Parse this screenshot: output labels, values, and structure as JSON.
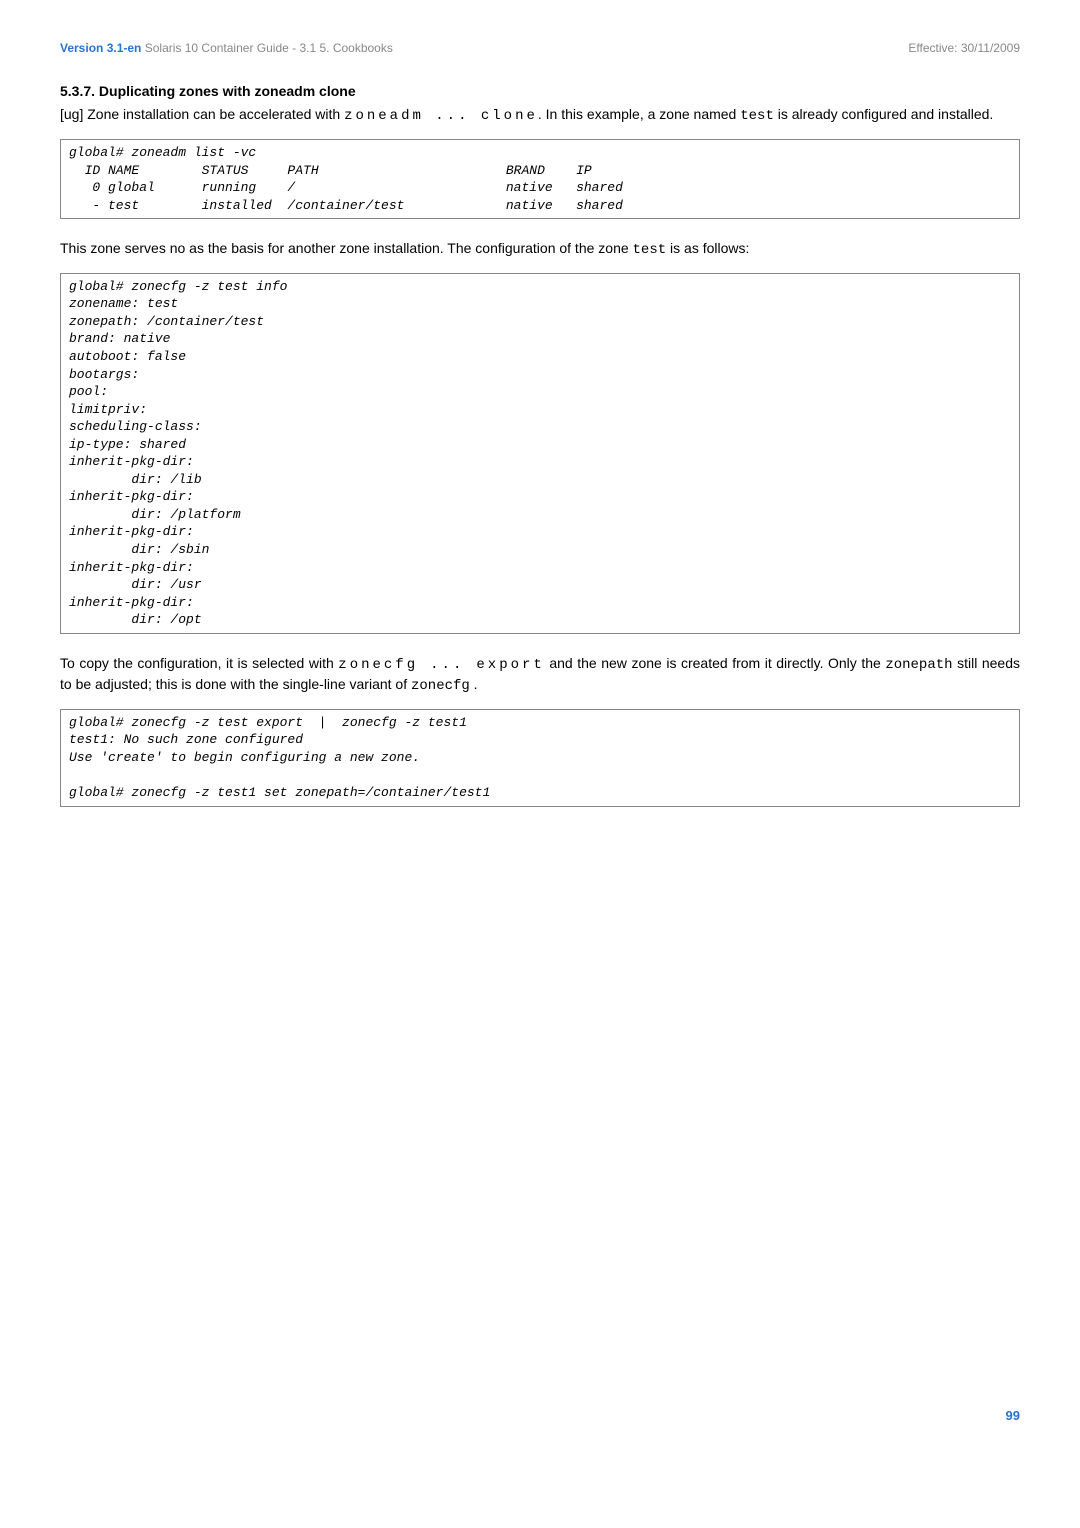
{
  "header": {
    "version": "Version 3.1-en",
    "title": "Solaris 10 Container Guide - 3.1  5. Cookbooks",
    "effective": "Effective: 30/11/2009"
  },
  "section": {
    "number": "5.3.7.",
    "title": "Duplicating zones with zoneadm clone"
  },
  "p1": {
    "prefix": "[ug] Zone installation can be accelerated with ",
    "cmd": "zoneadm ... clone",
    "mid": ". In this example, a zone named ",
    "name": "test",
    "suffix": " is already configured and installed."
  },
  "code1": "global# zoneadm list -vc\n  ID NAME        STATUS     PATH                        BRAND    IP\n   0 global      running    /                           native   shared\n   - test        installed  /container/test             native   shared",
  "p2": {
    "prefix": "This zone serves no as the basis for another zone installation. The configuration of the zone ",
    "name": "test",
    "suffix": " is as follows:"
  },
  "code2": "global# zonecfg -z test info\nzonename: test\nzonepath: /container/test\nbrand: native\nautoboot: false\nbootargs:\npool:\nlimitpriv:\nscheduling-class:\nip-type: shared\ninherit-pkg-dir:\n        dir: /lib\ninherit-pkg-dir:\n        dir: /platform\ninherit-pkg-dir:\n        dir: /sbin\ninherit-pkg-dir:\n        dir: /usr\ninherit-pkg-dir:\n        dir: /opt",
  "p3": {
    "prefix": "To copy the configuration, it is selected with ",
    "cmd": "zonecfg ... export",
    "mid1": " and the new zone is created from it directly. Only the ",
    "zp": "zonepath",
    "mid2": " still needs to be adjusted; this is done with the single-line variant of ",
    "zc": "zonecfg",
    "suffix": " ."
  },
  "code3": "global# zonecfg -z test export  |  zonecfg -z test1\ntest1: No such zone configured\nUse 'create' to begin configuring a new zone.\n\nglobal# zonecfg -z test1 set zonepath=/container/test1",
  "page": "99"
}
